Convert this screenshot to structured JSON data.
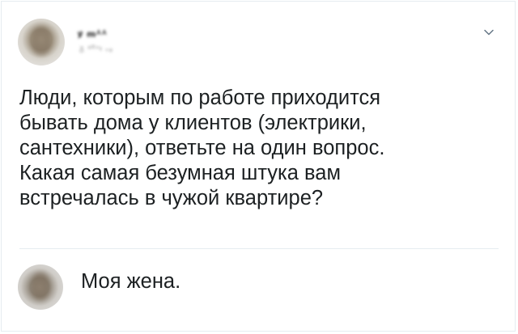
{
  "tweet": {
    "author_name": "ꝟ ᵯᴬᴬ",
    "author_handle": "ᵹ ᵃᴿᵸᵻ ᵥᵩ",
    "menu_icon": "chevron-down-icon",
    "text_lines": [
      "Люди, которым по работе приходится",
      "бывать дома у клиентов (электрики,",
      "сантехники), ответьте на один вопрос.",
      "Какая самая безумная штука вам",
      "встречалась в чужой квартире?"
    ]
  },
  "reply": {
    "text": "Моя жена."
  },
  "colors": {
    "text": "#1c2022",
    "border": "#e6ecf0",
    "chevron": "#657786"
  }
}
